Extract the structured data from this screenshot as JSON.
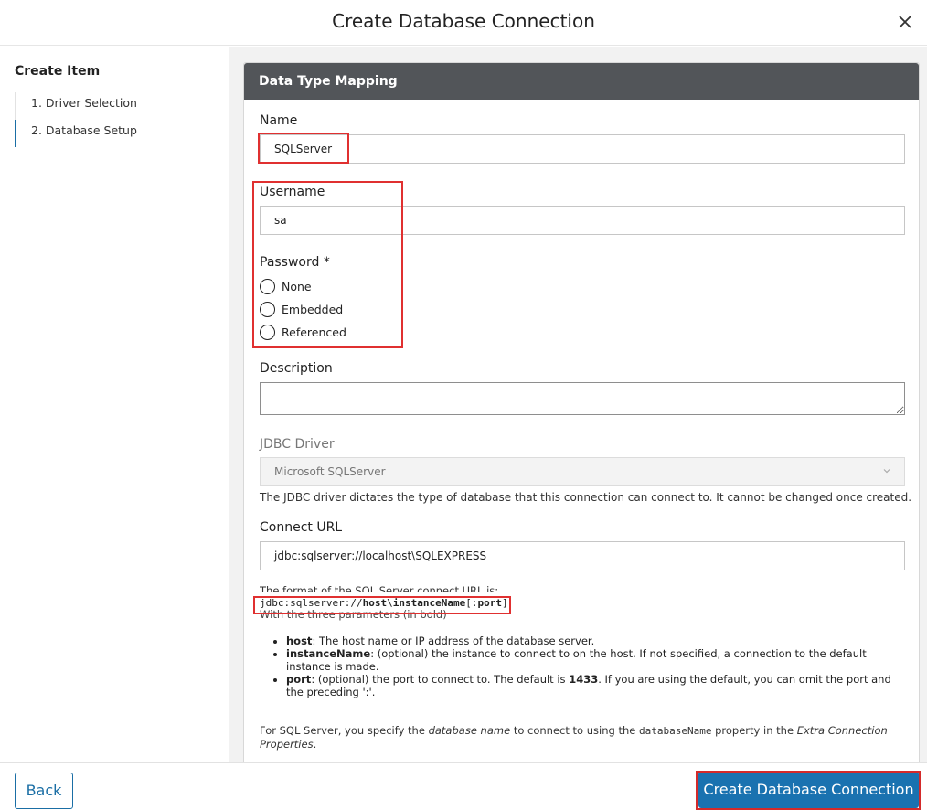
{
  "dialog": {
    "title": "Create Database Connection"
  },
  "sidebar": {
    "heading": "Create Item",
    "steps": [
      {
        "label": "1. Driver Selection"
      },
      {
        "label": "2. Database Setup"
      }
    ]
  },
  "panel": {
    "heading": "Data Type Mapping",
    "name": {
      "label": "Name",
      "value": "SQLServer"
    },
    "username": {
      "label": "Username",
      "value": "sa"
    },
    "password": {
      "label": "Password *",
      "options": [
        "None",
        "Embedded",
        "Referenced"
      ]
    },
    "description": {
      "label": "Description",
      "value": ""
    },
    "jdbc": {
      "label": "JDBC Driver",
      "selected": "Microsoft SQLServer",
      "help": "The JDBC driver dictates the type of database that this connection can connect to. It cannot be changed once created."
    },
    "connect_url": {
      "label": "Connect URL",
      "value": "jdbc:sqlserver://localhost\\SQLEXPRESS"
    },
    "format": {
      "intro": "The format of the SQL Server connect URL is:",
      "code_prefix": "jdbc:sqlserver://",
      "code_host": "host",
      "code_sep": "\\",
      "code_instance": "instanceName",
      "code_port_open": "[:",
      "code_port": "port",
      "code_port_close": "]",
      "with_params": "With the three parameters (in bold)",
      "params": [
        {
          "name": "host",
          "text": ": The host name or IP address of the database server."
        },
        {
          "name": "instanceName",
          "text": ": (optional) the instance to connect to on the host. If not specified, a connection to the default instance is made."
        },
        {
          "name": "port",
          "text_a": ": (optional) the port to connect to. The default is ",
          "default": "1433",
          "text_b": ". If you are using the default, you can omit the port and the preceding ':'."
        }
      ],
      "note_a": "For SQL Server, you specify the ",
      "note_em1": "database name",
      "note_b": " to connect to using the ",
      "note_code": "databaseName",
      "note_c": " property in the ",
      "note_em2": "Extra Connection Properties",
      "note_d": "."
    }
  },
  "footer": {
    "back_label": "Back",
    "create_label": "Create Database Connection"
  }
}
